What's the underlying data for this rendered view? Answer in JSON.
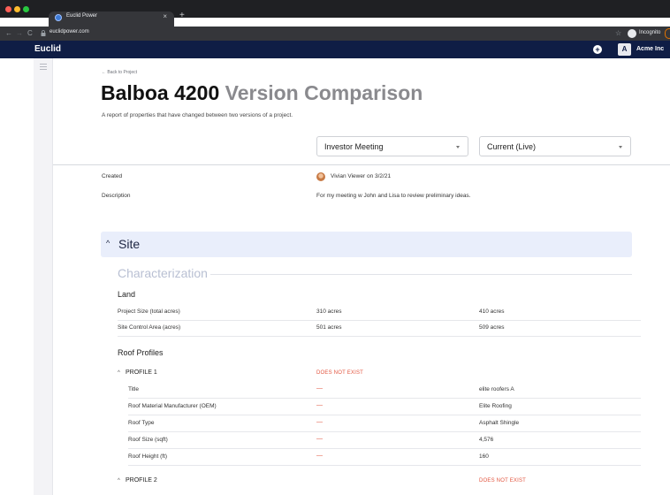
{
  "browser": {
    "tab_title": "Euclid Power",
    "tab_close": "×",
    "new_tab": "+",
    "url": "euclidpower.com",
    "incognito_label": "Incognito"
  },
  "app": {
    "brand": "Euclid",
    "org_initial": "A",
    "org_name": "Acme Inc"
  },
  "page": {
    "back_link": "← Back to Project",
    "title_main": "Balboa 4200",
    "title_rest": " Version Comparison",
    "subtitle": "A report of properties that have changed between two versions of a project.",
    "left_version": "Investor Meeting",
    "right_version": "Current (Live)"
  },
  "meta": {
    "created_label": "Created",
    "created_value": "Vivian Viewer on 3/2/21",
    "description_label": "Description",
    "description_value": "For my meeting w John and Lisa to review preliminary ideas."
  },
  "section": {
    "chevron": "^",
    "title": "Site",
    "subsection": "Characterization",
    "land_title": "Land",
    "land_rows": [
      {
        "label": "Project Size (total acres)",
        "left": "310 acres",
        "right": "410 acres"
      },
      {
        "label": "Site Control Area (acres)",
        "left": "501 acres",
        "right": "509 acres"
      }
    ],
    "roof_title": "Roof Profiles",
    "does_not_exist": "DOES NOT EXIST",
    "dash": "—",
    "profile1": {
      "chevron": "^",
      "title": "PROFILE 1",
      "rows": [
        {
          "label": "Title",
          "right": "elite roofers A"
        },
        {
          "label": "Roof Material Manufacturer (OEM)",
          "right": "Elite Roofing"
        },
        {
          "label": "Roof Type",
          "right": "Asphalt Shingle"
        },
        {
          "label": "Roof Size (sqft)",
          "right": "4,576"
        },
        {
          "label": "Roof Height (ft)",
          "right": "160"
        }
      ]
    },
    "profile2": {
      "chevron": "^",
      "title": "PROFILE 2"
    }
  }
}
